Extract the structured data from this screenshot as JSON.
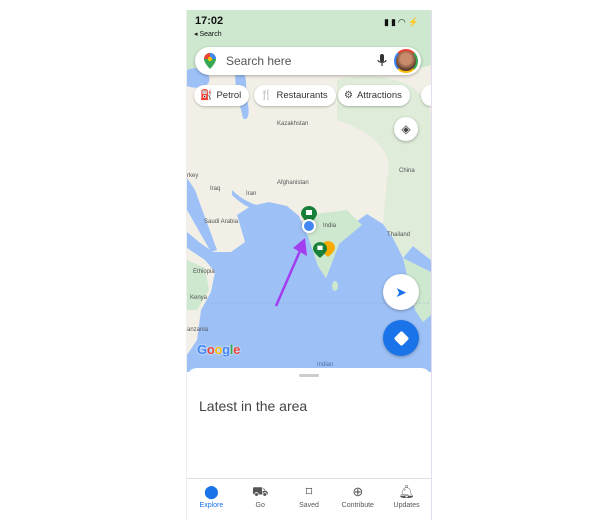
{
  "status_bar": {
    "time": "17:02",
    "back_label": "◂ Search",
    "icons": [
      "signal-icon",
      "wifi-icon",
      "battery-charging-icon"
    ]
  },
  "search": {
    "placeholder": "Search here"
  },
  "chips": [
    {
      "label": "Petrol",
      "icon": "fuel-icon"
    },
    {
      "label": "Restaurants",
      "icon": "restaurant-icon"
    },
    {
      "label": "Attractions",
      "icon": "attractions-icon"
    }
  ],
  "map": {
    "labels": {
      "kazakhstan": "Kazakhstan",
      "turkey": "rkey",
      "afghanistan": "Afghanistan",
      "iraq": "Iraq",
      "iran": "Iran",
      "saudi": "Saudi Arabia",
      "india": "India",
      "china": "China",
      "thailand": "Thailand",
      "ethiopia": "Ethiopia",
      "kenya": "Kenya",
      "tanzania": "anzania",
      "indian": "Indian"
    },
    "logo": "Google",
    "colors": {
      "sea": "#9dc1f7",
      "land": "#f2efe6",
      "green": "#cde8cf",
      "accent": "#1a73e8",
      "annotation_arrow": "#a23ef0"
    }
  },
  "sheet": {
    "title": "Latest in the area"
  },
  "nav": [
    {
      "label": "Explore",
      "icon": "pin-icon",
      "active": true
    },
    {
      "label": "Go",
      "icon": "commute-icon"
    },
    {
      "label": "Saved",
      "icon": "bookmark-icon"
    },
    {
      "label": "Contribute",
      "icon": "add-circle-icon"
    },
    {
      "label": "Updates",
      "icon": "bell-icon"
    }
  ]
}
